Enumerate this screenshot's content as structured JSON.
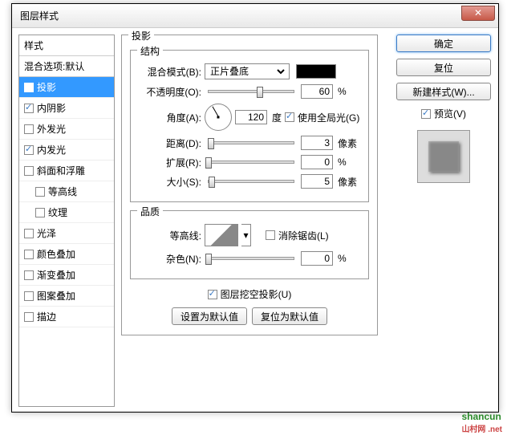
{
  "window": {
    "title": "图层样式"
  },
  "sidebar": {
    "header": "样式",
    "blend_header": "混合选项:默认",
    "items": [
      {
        "label": "投影",
        "checked": true,
        "active": true,
        "indent": false
      },
      {
        "label": "内阴影",
        "checked": true,
        "active": false,
        "indent": false
      },
      {
        "label": "外发光",
        "checked": false,
        "active": false,
        "indent": false
      },
      {
        "label": "内发光",
        "checked": true,
        "active": false,
        "indent": false
      },
      {
        "label": "斜面和浮雕",
        "checked": false,
        "active": false,
        "indent": false
      },
      {
        "label": "等高线",
        "checked": false,
        "active": false,
        "indent": true
      },
      {
        "label": "纹理",
        "checked": false,
        "active": false,
        "indent": true
      },
      {
        "label": "光泽",
        "checked": false,
        "active": false,
        "indent": false
      },
      {
        "label": "颜色叠加",
        "checked": false,
        "active": false,
        "indent": false
      },
      {
        "label": "渐变叠加",
        "checked": false,
        "active": false,
        "indent": false
      },
      {
        "label": "图案叠加",
        "checked": false,
        "active": false,
        "indent": false
      },
      {
        "label": "描边",
        "checked": false,
        "active": false,
        "indent": false
      }
    ]
  },
  "main": {
    "title": "投影",
    "structure": {
      "title": "结构",
      "blend_mode_label": "混合模式(B):",
      "blend_mode_value": "正片叠底",
      "opacity_label": "不透明度(O):",
      "opacity_value": "60",
      "opacity_unit": "%",
      "angle_label": "角度(A):",
      "angle_value": "120",
      "angle_unit": "度",
      "global_light_label": "使用全局光(G)",
      "global_light_checked": true,
      "distance_label": "距离(D):",
      "distance_value": "3",
      "distance_unit": "像素",
      "spread_label": "扩展(R):",
      "spread_value": "0",
      "spread_unit": "%",
      "size_label": "大小(S):",
      "size_value": "5",
      "size_unit": "像素"
    },
    "quality": {
      "title": "品质",
      "contour_label": "等高线:",
      "antialias_label": "消除锯齿(L)",
      "antialias_checked": false,
      "noise_label": "杂色(N):",
      "noise_value": "0",
      "noise_unit": "%"
    },
    "knockout_label": "图层挖空投影(U)",
    "knockout_checked": true,
    "make_default": "设置为默认值",
    "reset_default": "复位为默认值"
  },
  "right": {
    "ok": "确定",
    "cancel": "复位",
    "new_style": "新建样式(W)...",
    "preview_label": "预览(V)",
    "preview_checked": true
  },
  "watermark": {
    "brand": "shancun",
    "sub": "山村网 .net"
  }
}
